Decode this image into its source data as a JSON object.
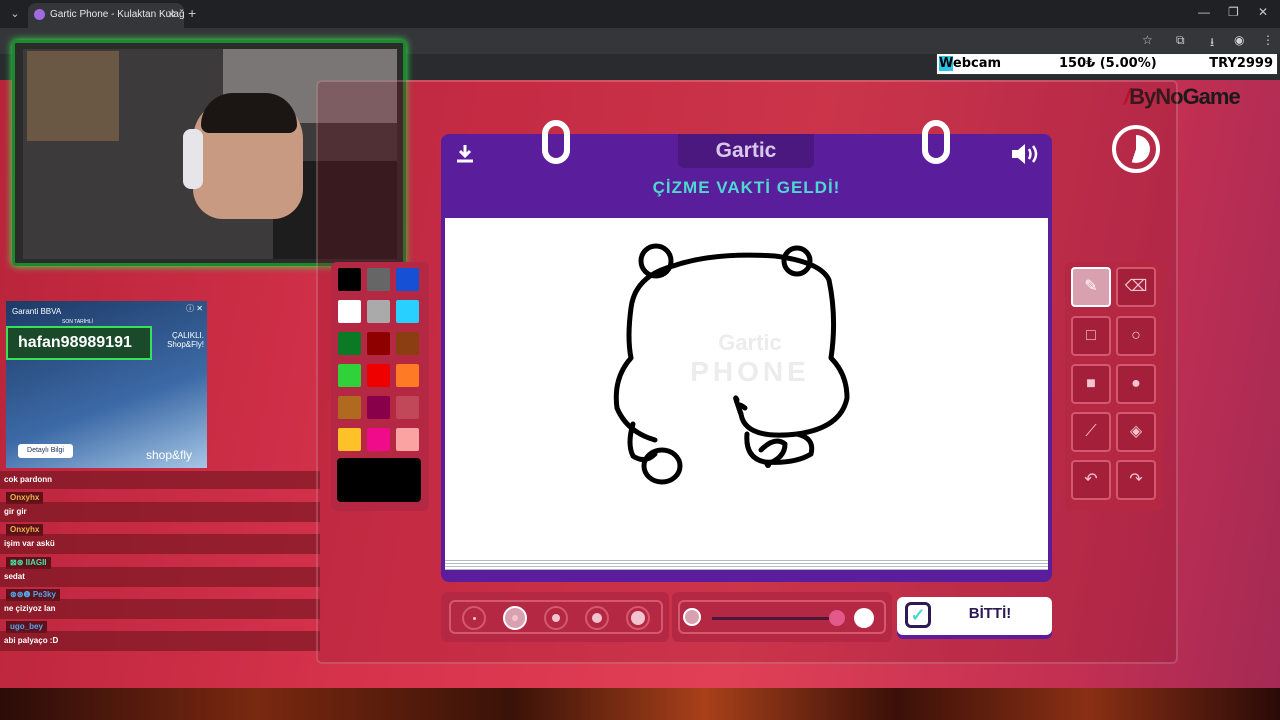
{
  "browser": {
    "tab_title": "Gartic Phone - Kulaktan Kulağa",
    "tab_close": "✕",
    "new_tab": "+",
    "tab_list": "⌄",
    "window_controls": {
      "minimize": "—",
      "maximize": "❐",
      "close": "✕"
    }
  },
  "overlay": {
    "donation_label_highlight": "W",
    "donation_label_rest": "ebcam",
    "donation_amount": "150₺ (5.00%)",
    "donation_code": "TRY2999",
    "sponsor_logo": "ByNoGame"
  },
  "ad": {
    "brand": "Garanti BBVA",
    "sub": "SON TARİHLİ",
    "headline": "ÇALIKLI. Shop&Fly!",
    "username": "hafan98989191",
    "button": "Detaylı Bilgi",
    "tagline": "shop&fly"
  },
  "chat": {
    "messages": [
      {
        "user": "",
        "text": "cok pardonn"
      },
      {
        "user": "Onxyhx",
        "text": "gir gir"
      },
      {
        "user": "Onxyhx",
        "text": "işim var askü"
      },
      {
        "user": "IIAGII",
        "text": "sedat"
      },
      {
        "user": "Pe3ky",
        "text": "ne çiziyoz lan"
      },
      {
        "user": "ugo_bey",
        "text": "abi palyaço :D"
      }
    ]
  },
  "game": {
    "logo": "Gartic",
    "header_title": "ÇİZME VAKTİ GELDİ!",
    "watermark_line1": "Gartic",
    "watermark_line2": "PHONE",
    "done_label": "BİTTİ!",
    "palette_colors": [
      "#000000",
      "#666666",
      "#1650d4",
      "#ffffff",
      "#aaaaaa",
      "#27d0ff",
      "#0b7a24",
      "#8e0000",
      "#8b3e12",
      "#2fd339",
      "#ee0000",
      "#ff7a24",
      "#b06a20",
      "#88004a",
      "#c04858",
      "#fec128",
      "#ef0b8a",
      "#fba3a3"
    ],
    "current_color": "#000000",
    "selected_tool": "pencil",
    "brush_size_selected": 2,
    "opacity_level": 1.0,
    "icons": {
      "download": "download-icon",
      "sound": "speaker-icon",
      "timer": "timer-icon",
      "pencil": "pencil-icon",
      "eraser": "eraser-icon",
      "rect": "square-outline-icon",
      "circle": "circle-outline-icon",
      "rect_fill": "square-filled-icon",
      "circle_fill": "circle-filled-icon",
      "line": "line-icon",
      "bucket": "fill-bucket-icon",
      "undo": "undo-icon",
      "redo": "redo-icon"
    }
  }
}
